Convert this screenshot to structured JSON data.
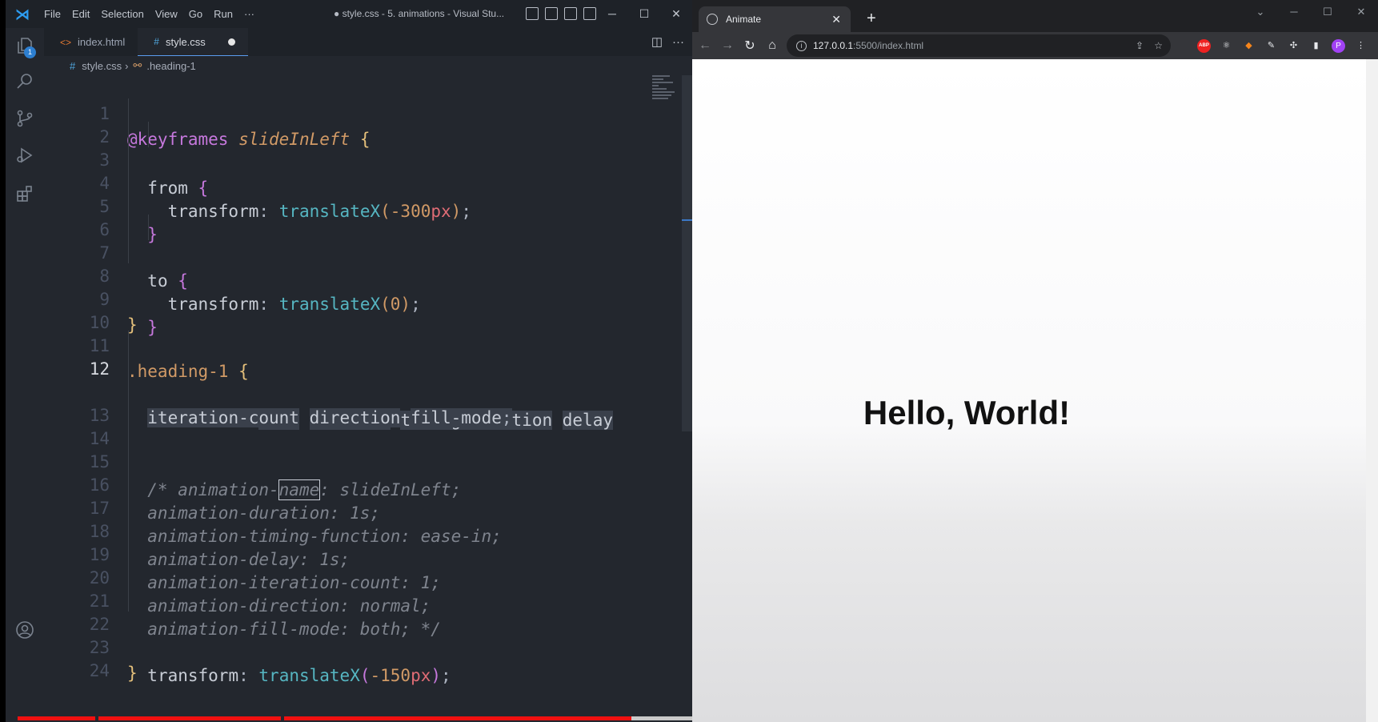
{
  "vscode": {
    "menu": [
      "File",
      "Edit",
      "Selection",
      "View",
      "Go",
      "Run",
      "···"
    ],
    "window_title": "● style.css - 5. animations - Visual Stu...",
    "tabs": [
      {
        "label": "index.html",
        "type": "html"
      },
      {
        "label": "style.css",
        "type": "css",
        "active": true,
        "dirty": true
      }
    ],
    "explorer_badge": "1",
    "breadcrumb": {
      "file": "style.css",
      "symbol": ".heading-1"
    },
    "active_line": 12
  },
  "browser": {
    "tab_title": "Animate",
    "url_host": "127.0.0.1",
    "url_path": ":5500/index.html",
    "profile_initial": "P",
    "page_heading": "Hello, World!"
  },
  "video_progress": 0.45
}
